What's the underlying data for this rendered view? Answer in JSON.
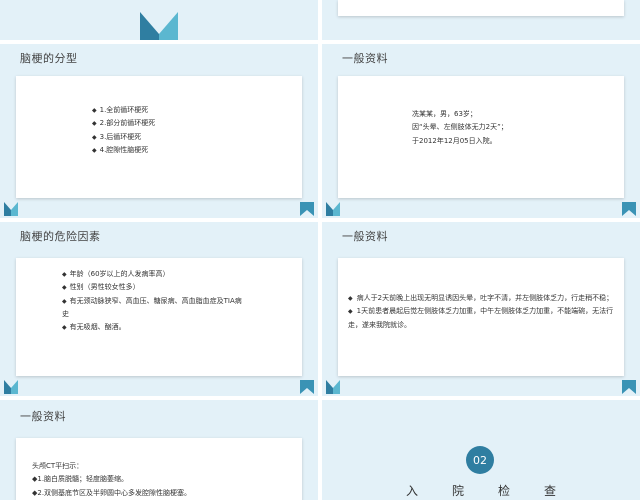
{
  "colors": {
    "bg": "#e3f1f8",
    "accent": "#2f7ea1",
    "accent_light": "#5bb7d0"
  },
  "slides": {
    "s1": {
      "title": "脑梗的分型",
      "items": [
        "1.全前循环梗死",
        "2.部分前循环梗死",
        "3.后循环梗死",
        "4.腔隙性脑梗死"
      ]
    },
    "s2": {
      "title": "一般资料",
      "lines": [
        "冼某某，男，63岁；",
        "因“头晕、左侧肢体无力2天”；",
        "于2012年12月05日入院。"
      ]
    },
    "s3": {
      "title": "脑梗的危险因素",
      "items": [
        "年龄（60岁以上的人发病率高）",
        "性别（男性较女性多）",
        "有无颈动脉狭窄、高血压、糖尿病、高血脂血症及TIA病",
        "史",
        "有无吸烟、酗酒。"
      ]
    },
    "s4": {
      "title": "一般资料",
      "paras": [
        "病人于2天前晚上出现无明显诱因头晕，吐字不清，并左侧肢体乏力，行走稍不稳；",
        "1天前患者晨起后觉左侧肢体乏力加重，中午左侧肢体乏力加重，不能端碗，无法行走，遂来我院就诊。"
      ]
    },
    "s5": {
      "title": "一般资料",
      "lines": [
        "头颅CT平扫示：",
        "◆1.脑白质脱髓；轻度脑萎缩。",
        "◆2.双侧基底节区及半卵圆中心多发腔隙性脑梗塞。"
      ]
    },
    "s6": {
      "number": "02",
      "heading_chars": [
        "入",
        "院",
        "检",
        "查"
      ]
    }
  }
}
